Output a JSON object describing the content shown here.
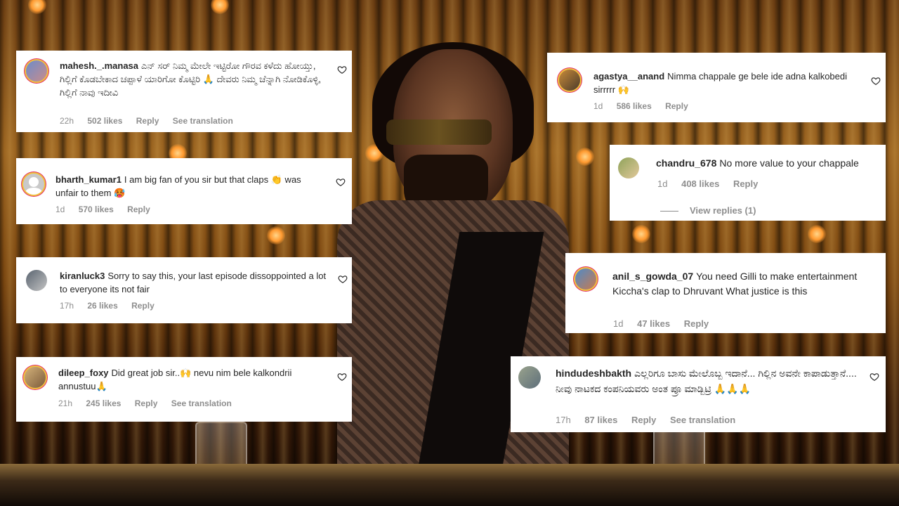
{
  "comments": [
    {
      "username": "mahesh._.manasa",
      "text": "ಎನ್ ಸರ್ ನಿಮ್ಮ ಮೇಲೇ ಇಟ್ಟಿರೋ ಗೌರವ ಕಳೆದು ಹೋಯ್ತು, ಗಿಲ್ಲಿಗೆ ಕೊಡಬೇಕಾದ ಚಪ್ಪಾಳೆ ಯಾರಿಗೋ ಕೊಟ್ಟಿರಿ 🙏 ದೇವರು ನಿಮ್ಮ ಚೆನ್ನಾಗಿ ನೋಡಿಕೊಳ್ಳಿ, ಗಿಲ್ಲಿಗೆ ನಾವು ಇದೀವಿ",
      "time": "22h",
      "likes": "502 likes",
      "reply": "Reply",
      "translation": "See translation",
      "avatar": "user-photo-avatar"
    },
    {
      "username": "bharth_kumar1",
      "text": "I am big fan of you sir but that claps 👏 was unfair to them 🥵",
      "time": "1d",
      "likes": "570 likes",
      "reply": "Reply",
      "avatar": "default-user-avatar"
    },
    {
      "username": "kiranluck3",
      "text": "Sorry to say this, your last episode dissoppointed a lot to everyone its not fair",
      "time": "17h",
      "likes": "26 likes",
      "reply": "Reply",
      "avatar": "user-photo-avatar"
    },
    {
      "username": "dileep_foxy",
      "text": "Did great job sir..🙌 nevu nim bele kalkondrii annustuu🙏",
      "time": "21h",
      "likes": "245 likes",
      "reply": "Reply",
      "translation": "See translation",
      "avatar": "user-photo-avatar"
    },
    {
      "username": "agastya__anand",
      "text": "Nimma chappale ge bele ide adna kalkobedi sirrrrr 🙌",
      "time": "1d",
      "likes": "586 likes",
      "reply": "Reply",
      "avatar": "user-photo-avatar"
    },
    {
      "username": "chandru_678",
      "text": "No more value to your chappale",
      "time": "1d",
      "likes": "408 likes",
      "reply": "Reply",
      "view_replies": "View replies (1)",
      "avatar": "user-photo-avatar"
    },
    {
      "username": "anil_s_gowda_07",
      "text": "You need Gilli to make entertainment Kiccha's clap to Dhruvant What justice is this",
      "time": "1d",
      "likes": "47 likes",
      "reply": "Reply",
      "avatar": "user-photo-avatar"
    },
    {
      "username": "hindudeshbakth",
      "text": "ಎಲ್ಲರಿಗೂ ಬಾಸು ಮೇಲೊಬ್ಬ ಇದಾನೆ... ಗಿಲ್ಲಿನ ಅವನೇ ಕಾಪಾಡುತ್ತಾನೆ.... ನೀವು ನಾಟಕದ ಕಂಪನಿಯವರು ಅಂತ ಪ್ರೂ ಮಾಡ್ಬಿಟ್ರಿ 🙏🙏🙏",
      "time": "17h",
      "likes": "87 likes",
      "reply": "Reply",
      "translation": "See translation",
      "avatar": "user-photo-avatar"
    }
  ],
  "icons": {
    "like": "heart-icon"
  },
  "colors": {
    "card_bg": "#ffffff",
    "meta_text": "#8e8e8e",
    "body_text": "#262626"
  }
}
